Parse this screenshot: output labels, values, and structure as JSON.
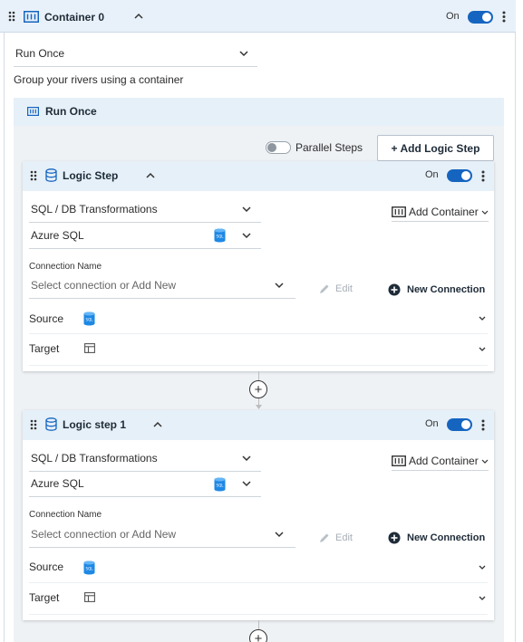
{
  "container": {
    "title": "Container 0",
    "toggle_label": "On",
    "toggle_on": true,
    "run_mode": "Run Once",
    "description": "Group your rivers using a container"
  },
  "run_once": {
    "title": "Run Once",
    "parallel_steps_label": "Parallel Steps",
    "parallel_steps_on": false,
    "add_logic_step_label": "+ Add Logic Step"
  },
  "steps": [
    {
      "title": "Logic Step",
      "toggle_label": "On",
      "toggle_on": true,
      "type": "SQL / DB Transformations",
      "db": "Azure SQL",
      "add_container_label": "Add Container",
      "connection_label": "Connection Name",
      "connection_placeholder": "Select connection or Add New",
      "edit_label": "Edit",
      "new_connection_label": "New Connection",
      "source_label": "Source",
      "target_label": "Target"
    },
    {
      "title": "Logic step 1",
      "toggle_label": "On",
      "toggle_on": true,
      "type": "SQL / DB Transformations",
      "db": "Azure SQL",
      "add_container_label": "Add Container",
      "connection_label": "Connection Name",
      "connection_placeholder": "Select connection or Add New",
      "edit_label": "Edit",
      "new_connection_label": "New Connection",
      "source_label": "Source",
      "target_label": "Target"
    }
  ],
  "colors": {
    "accent": "#1565c0",
    "header_bg": "#e8f1f9",
    "sql_icon": "#1e88e5"
  }
}
